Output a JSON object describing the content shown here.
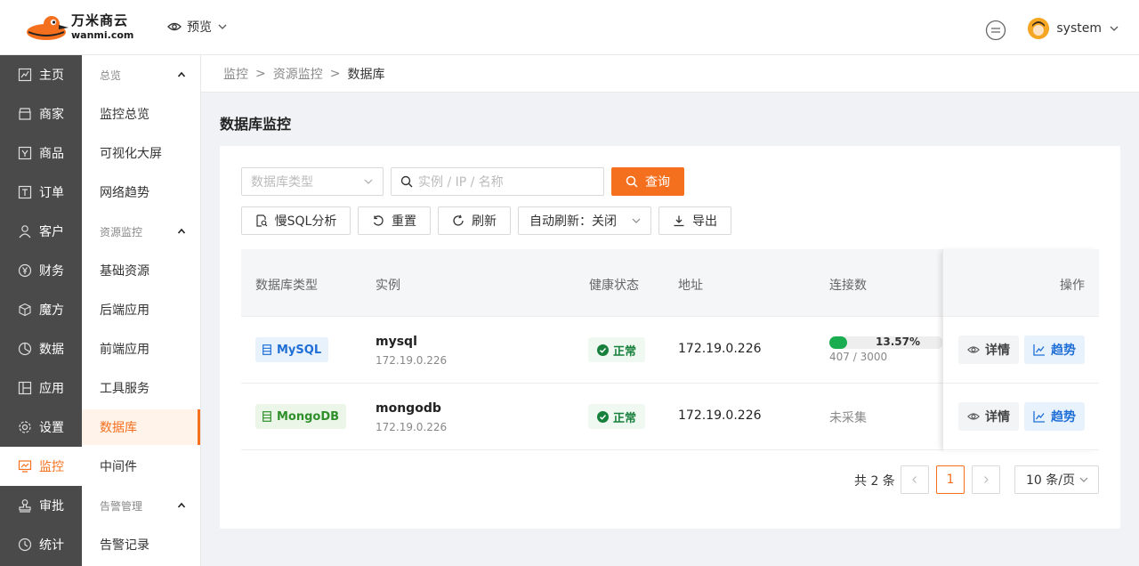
{
  "brand": {
    "name": "万米商云",
    "domain": "wanmi.com"
  },
  "header": {
    "preview_label": "预览",
    "username": "system"
  },
  "nav_primary": [
    {
      "label": "主页",
      "icon": "chart-board-icon"
    },
    {
      "label": "商家",
      "icon": "store-icon"
    },
    {
      "label": "商品",
      "icon": "goods-icon"
    },
    {
      "label": "订单",
      "icon": "order-icon"
    },
    {
      "label": "客户",
      "icon": "user-icon"
    },
    {
      "label": "财务",
      "icon": "yen-icon"
    },
    {
      "label": "魔方",
      "icon": "cube-icon"
    },
    {
      "label": "数据",
      "icon": "pie-icon"
    },
    {
      "label": "应用",
      "icon": "app-icon"
    },
    {
      "label": "设置",
      "icon": "gear-icon"
    },
    {
      "label": "监控",
      "icon": "monitor-icon"
    },
    {
      "label": "审批",
      "icon": "stamp-icon"
    },
    {
      "label": "统计",
      "icon": "stats-icon"
    }
  ],
  "nav_secondary": {
    "group1": "总览",
    "group1_items": [
      "监控总览",
      "可视化大屏",
      "网络趋势"
    ],
    "group2": "资源监控",
    "group2_items": [
      "基础资源",
      "后端应用",
      "前端应用",
      "工具服务",
      "数据库",
      "中间件"
    ],
    "group3": "告警管理",
    "group3_items": [
      "告警记录"
    ]
  },
  "breadcrumb": [
    "监控",
    "资源监控",
    "数据库"
  ],
  "page_title": "数据库监控",
  "filters": {
    "type_placeholder": "数据库类型",
    "search_placeholder": "实例 / IP / 名称",
    "query_label": "查询"
  },
  "toolbar": {
    "slow_sql": "慢SQL分析",
    "reset": "重置",
    "refresh": "刷新",
    "auto_refresh": "自动刷新：关闭",
    "export": "导出"
  },
  "table": {
    "columns": [
      "数据库类型",
      "实例",
      "健康状态",
      "地址",
      "连接数",
      "操作"
    ],
    "rows": [
      {
        "type": "MySQL",
        "name": "mysql",
        "ip": "172.19.0.226",
        "health": "正常",
        "address": "172.19.0.226",
        "conn_pct": "13.57%",
        "conn_fraction": 0.1357,
        "conn_count": "407 / 3000"
      },
      {
        "type": "MongoDB",
        "name": "mongodb",
        "ip": "172.19.0.226",
        "health": "正常",
        "address": "172.19.0.226",
        "conn_text": "未采集"
      }
    ],
    "action_detail": "详情",
    "action_trend": "趋势"
  },
  "pagination": {
    "total": "共 2 条",
    "current": "1",
    "page_size": "10 条/页"
  },
  "colors": {
    "accent": "#f5701e",
    "nav_bg": "#4a4a4a",
    "mysql_tag": "#1f6fd6",
    "mongodb_tag": "#2f8f2a",
    "healthy": "#16803c"
  }
}
